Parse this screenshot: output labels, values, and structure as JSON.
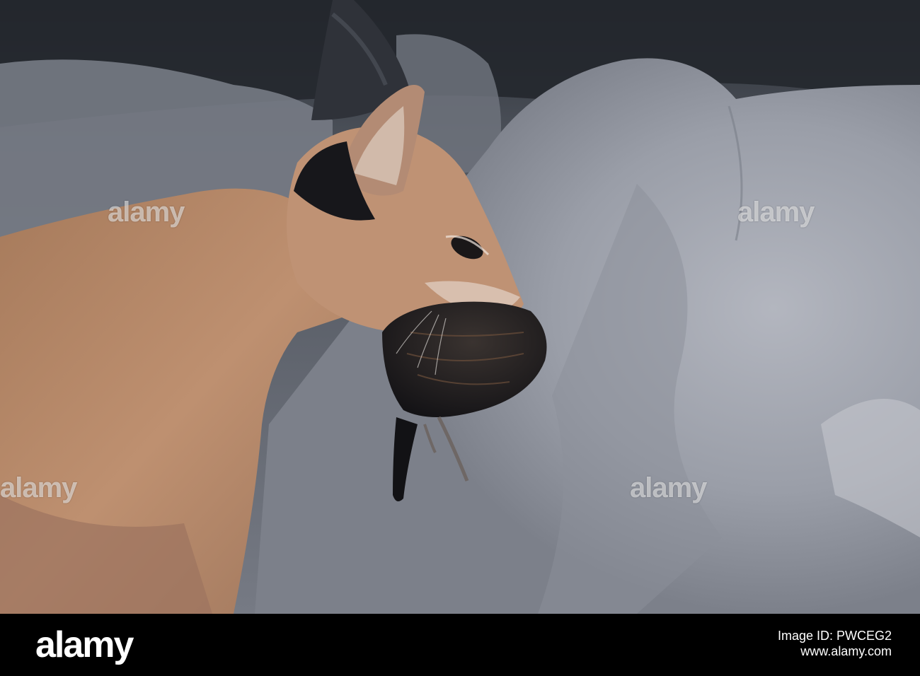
{
  "photo": {
    "subject": "caracal-with-bird-in-mouth",
    "watermark_text": "alamy"
  },
  "footer": {
    "brand": "alamy",
    "image_id": "Image ID: PWCEG2",
    "site": "www.alamy.com"
  },
  "colors": {
    "fur": "#b98a68",
    "ear_dark": "#2b2e35",
    "rock": "#9a9ea8",
    "shadow_bg": "#2a2e36",
    "bird": "#1c1a1c",
    "footer_bg": "#000000"
  }
}
